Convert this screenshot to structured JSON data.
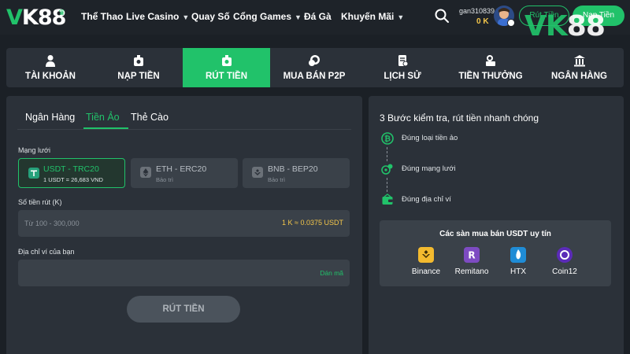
{
  "brand": {
    "logo_text_v": "V",
    "logo_text_rest": "K88",
    "watermark_a": "VK",
    "watermark_b": "88",
    "accent": "#21c26a"
  },
  "topnav": {
    "items": [
      {
        "label": "Thể Thao",
        "dropdown": false
      },
      {
        "label": "Live Casino",
        "dropdown": true
      },
      {
        "label": "Quay Số",
        "dropdown": false
      },
      {
        "label": "Cổng Games",
        "dropdown": true
      },
      {
        "label": "Đá Gà",
        "dropdown": false
      },
      {
        "label": "Khuyến Mãi",
        "dropdown": true
      }
    ],
    "username": "gan310839",
    "balance": "0 K",
    "withdraw_btn": "Rút Tiền",
    "deposit_btn": "Nạp Tiền"
  },
  "tabs": [
    {
      "label": "TÀI KHOẢN",
      "icon": "user-icon",
      "active": false
    },
    {
      "label": "NẠP TIỀN",
      "icon": "deposit-icon",
      "active": false
    },
    {
      "label": "RÚT TIỀN",
      "icon": "withdraw-icon",
      "active": true
    },
    {
      "label": "MUA BÁN P2P",
      "icon": "coins-icon",
      "active": false
    },
    {
      "label": "LỊCH SỬ",
      "icon": "history-icon",
      "active": false
    },
    {
      "label": "TIỀN THƯỞNG",
      "icon": "bonus-icon",
      "active": false
    },
    {
      "label": "NGÂN HÀNG",
      "icon": "bank-icon",
      "active": false
    }
  ],
  "withdraw": {
    "subtabs": [
      {
        "label": "Ngân Hàng",
        "active": false
      },
      {
        "label": "Tiền Ảo",
        "active": true
      },
      {
        "label": "Thẻ Cào",
        "active": false
      }
    ],
    "network_label": "Mạng lưới",
    "networks": [
      {
        "title": "USDT - TRC20",
        "sub": "1 USDT = 26,683 VND",
        "active": true,
        "icon": "tether-icon",
        "color": "#26a17b"
      },
      {
        "title": "ETH - ERC20",
        "sub": "Bảo trì",
        "active": false,
        "icon": "ethereum-icon",
        "color": "#6b7178"
      },
      {
        "title": "BNB - BEP20",
        "sub": "Bảo trì",
        "active": false,
        "icon": "bnb-icon",
        "color": "#6b7178"
      }
    ],
    "amount_label": "Số tiền rút (K)",
    "amount_placeholder": "Từ 100 - 300,000",
    "amount_value": "",
    "rate": "1 K ≈ 0.0375 USDT",
    "address_label": "Địa chỉ ví của bạn",
    "address_value": "",
    "paste_label": "Dán mã",
    "submit_label": "RÚT TIỀN"
  },
  "guide": {
    "title": "3 Bước kiểm tra, rút tiền nhanh chóng",
    "steps": [
      {
        "label": "Đúng loại tiền ảo",
        "icon": "bitcoin-icon"
      },
      {
        "label": "Đúng mạng lưới",
        "icon": "network-icon"
      },
      {
        "label": "Đúng địa chỉ ví",
        "icon": "wallet-icon"
      }
    ],
    "exchanges_title": "Các sàn mua bán USDT uy tín",
    "exchanges": [
      {
        "name": "Binance",
        "icon": "binance-icon",
        "color": "#f3ba2f"
      },
      {
        "name": "Remitano",
        "icon": "remitano-icon",
        "color": "#7d4bc2"
      },
      {
        "name": "HTX",
        "icon": "htx-icon",
        "color": "#1f8cd6"
      },
      {
        "name": "Coin12",
        "icon": "coin12-icon",
        "color": "#5b2bb8"
      }
    ]
  }
}
